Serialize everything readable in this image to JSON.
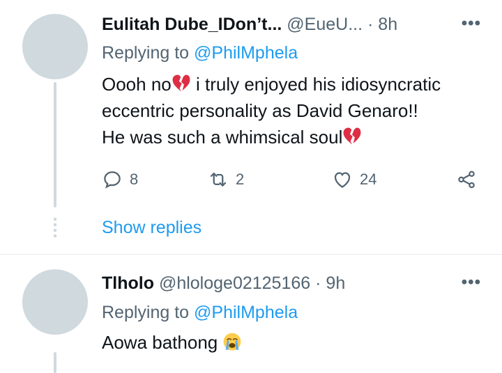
{
  "tweets": [
    {
      "name": "Eulitah Dube_IDon’t...",
      "handle": "@EueU...",
      "time": "· 8h",
      "more": "•••",
      "replying_prefix": "Replying to ",
      "replying_handle": "@PhilMphela",
      "text_line1_a": "Oooh no",
      "text_line1_b": " i truly enjoyed his idiosyncratic",
      "text_line2": "eccentric personality as David Genaro!!",
      "text_line3": "He was such a whimsical soul",
      "emoji_1": "broken-heart-icon",
      "emoji_2": "broken-heart-icon",
      "actions": {
        "replies": "8",
        "retweets": "2",
        "likes": "24"
      },
      "show_replies": "Show replies"
    },
    {
      "name": "Tlholo",
      "handle": "@hlologe02125166",
      "time": "· 9h",
      "more": "•••",
      "replying_prefix": "Replying to ",
      "replying_handle": "@PhilMphela",
      "text": "Aowa bathong ",
      "emoji": "loudly-crying-face-icon"
    }
  ],
  "colors": {
    "accent": "#1d9bf0",
    "secondary_text": "#536471",
    "avatar_placeholder": "#cfd9de",
    "heart_red": "#dd2e44"
  }
}
